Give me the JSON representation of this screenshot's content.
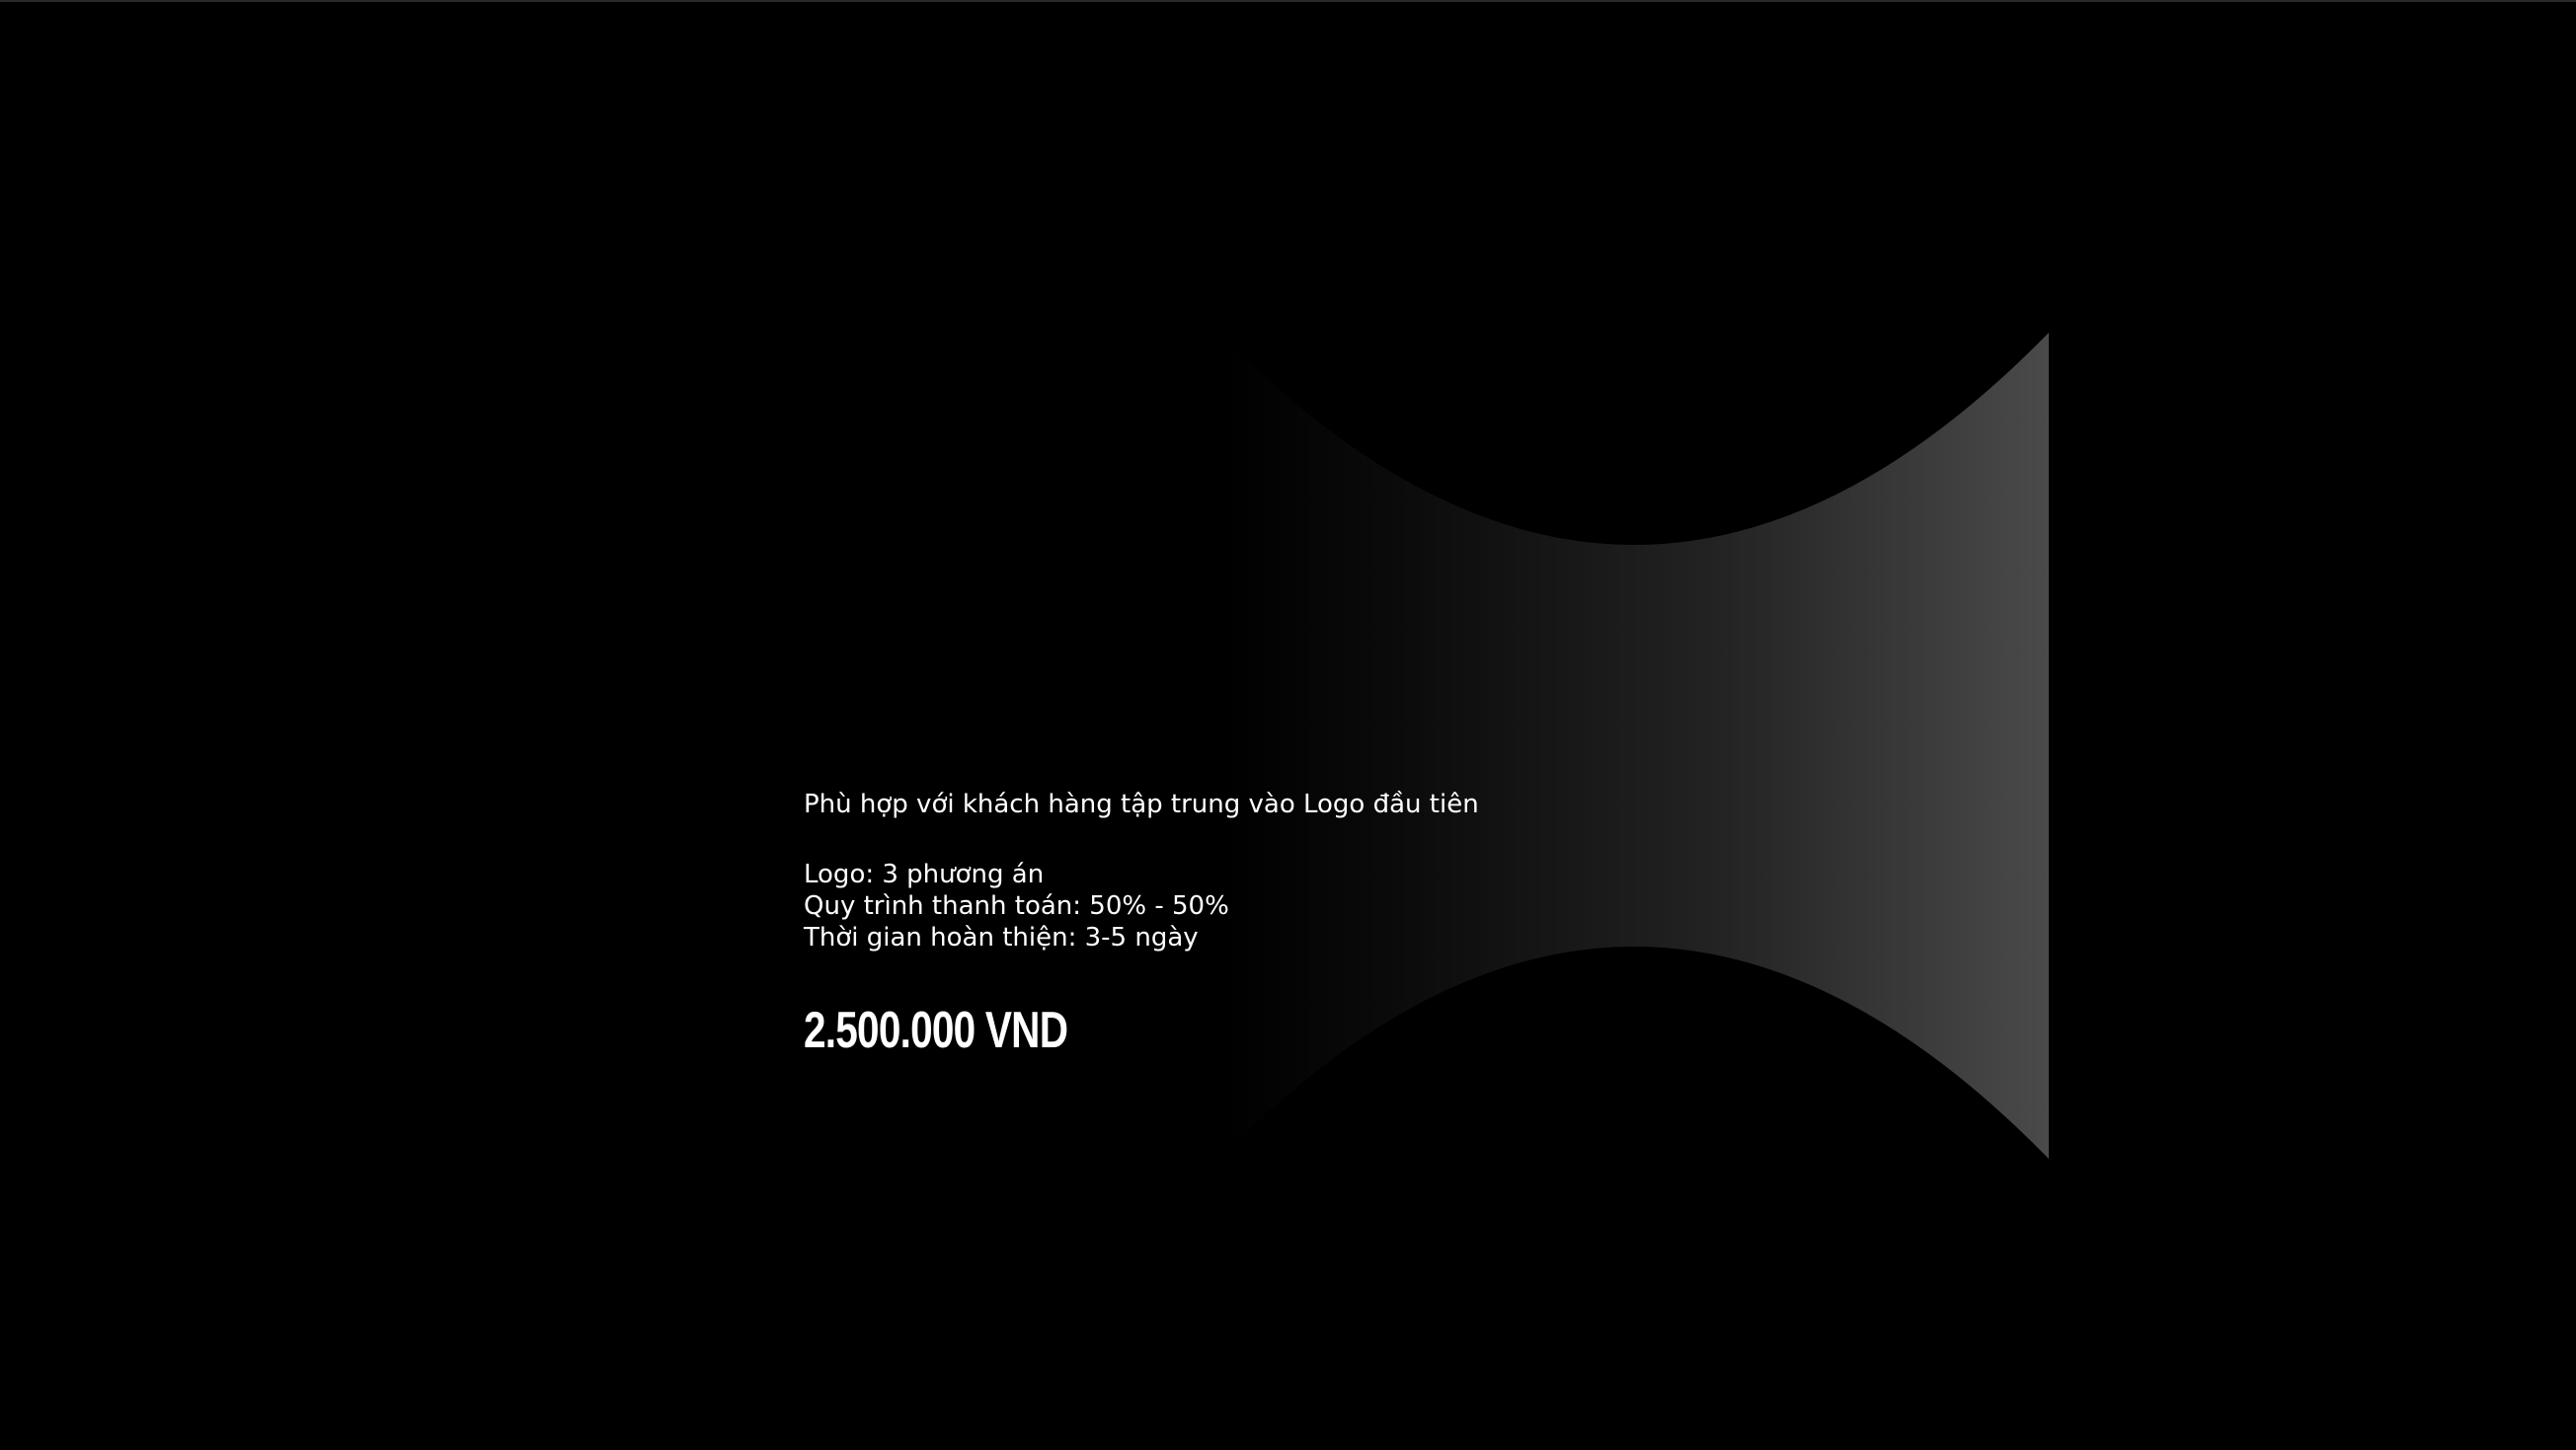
{
  "offer": {
    "intro": "Phù hợp với khách hàng tập trung vào Logo đầu tiên",
    "details": [
      "Logo: 3 phương án",
      "Quy trình thanh toán: 50% - 50%",
      "Thời gian hoàn thiện: 3-5 ngày"
    ],
    "price": "2.500.000 VND"
  },
  "colors": {
    "background": "#000000",
    "text": "#ffffff",
    "shape_light": "#4a4a4a"
  }
}
